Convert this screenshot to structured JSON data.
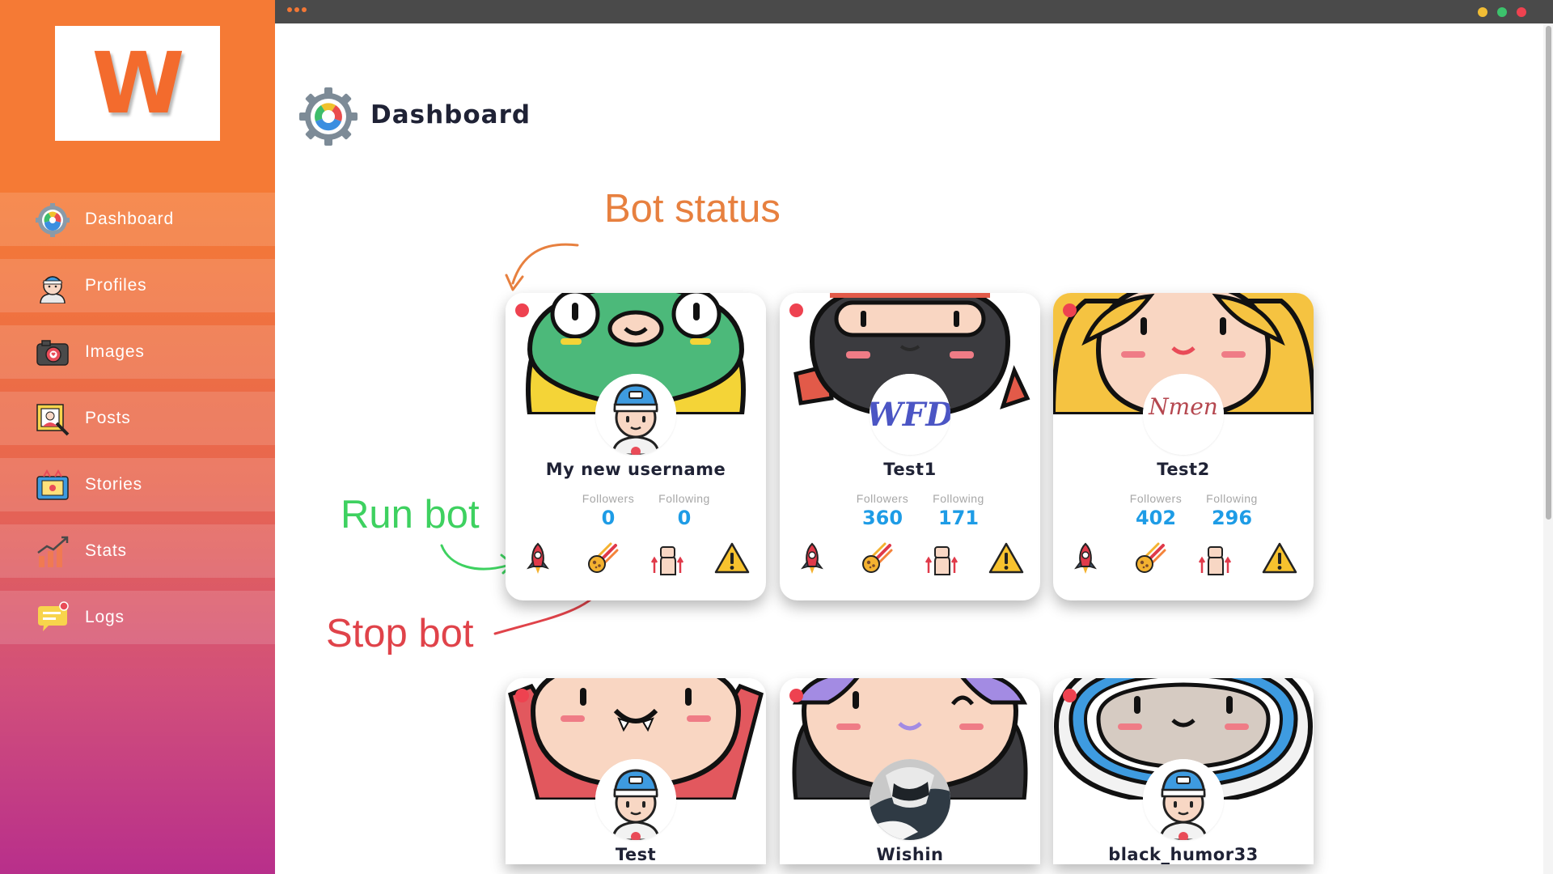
{
  "logo": {
    "letter": "W"
  },
  "sidebar": {
    "items": [
      {
        "label": "Dashboard",
        "icon": "dashboard-gauge-icon"
      },
      {
        "label": "Profiles",
        "icon": "user-avatar-icon"
      },
      {
        "label": "Images",
        "icon": "camera-icon"
      },
      {
        "label": "Posts",
        "icon": "post-picture-icon"
      },
      {
        "label": "Stories",
        "icon": "stories-icon"
      },
      {
        "label": "Stats",
        "icon": "bar-chart-icon"
      },
      {
        "label": "Logs",
        "icon": "chat-bubble-icon"
      }
    ]
  },
  "page": {
    "title": "Dashboard",
    "icon": "dashboard-gauge-icon"
  },
  "annotations": {
    "bot_status": "Bot status",
    "run_bot": "Run bot",
    "stop_bot": "Stop bot"
  },
  "cards": [
    {
      "username": "My new username",
      "followers_label": "Followers",
      "followers": "0",
      "following_label": "Following",
      "following": "0",
      "status": "stopped",
      "avatar": "boy-cap-avatar",
      "cover": "green-monster-cover"
    },
    {
      "username": "Test1",
      "followers_label": "Followers",
      "followers": "360",
      "following_label": "Following",
      "following": "171",
      "status": "stopped",
      "avatar": "WFD",
      "cover": "ninja-cover"
    },
    {
      "username": "Test2",
      "followers_label": "Followers",
      "followers": "402",
      "following_label": "Following",
      "following": "296",
      "status": "stopped",
      "avatar": "Nmen",
      "cover": "blonde-girl-cover"
    },
    {
      "username": "Test",
      "status": "stopped",
      "avatar": "boy-cap-avatar",
      "cover": "vampire-cover"
    },
    {
      "username": "Wishin",
      "status": "stopped",
      "avatar": "photo-avatar",
      "cover": "purple-hair-cover"
    },
    {
      "username": "black_humor33",
      "status": "stopped",
      "avatar": "boy-cap-avatar",
      "cover": "astronaut-cover"
    }
  ],
  "actions": [
    "rocket-icon",
    "meteor-icon",
    "raised-fist-icon",
    "warning-icon"
  ],
  "colors": {
    "accent": "#f57a35",
    "status_dot": "#ee4250",
    "stat_value": "#1e9ce6",
    "run_note": "#3ed160",
    "stop_note": "#e0434a",
    "status_note": "#e7803f"
  }
}
